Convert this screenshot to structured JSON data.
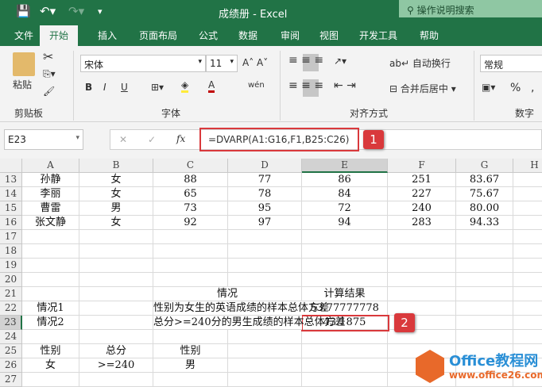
{
  "title_bar": {
    "title": "成绩册  -  Excel",
    "search": "操作说明搜索"
  },
  "tabs": [
    "文件",
    "开始",
    "插入",
    "页面布局",
    "公式",
    "数据",
    "审阅",
    "视图",
    "开发工具",
    "帮助"
  ],
  "ribbon": {
    "paste": "粘贴",
    "font_name": "宋体",
    "font_size": "11",
    "wrap": "自动换行",
    "merge": "合并后居中",
    "number_format": "常规",
    "groups": {
      "clipboard": "剪贴板",
      "font": "字体",
      "align": "对齐方式",
      "number": "数字"
    },
    "bold": "B",
    "italic": "I",
    "underline": "U",
    "percent": "%",
    "comma": ","
  },
  "formula_bar": {
    "name_box": "E23",
    "fx": "fx",
    "formula": "=DVARP(A1:G16,F1,B25:C26)"
  },
  "badges": [
    "1",
    "2"
  ],
  "columns": [
    "A",
    "B",
    "C",
    "D",
    "E",
    "F",
    "G",
    "H"
  ],
  "rows": [
    {
      "n": "13",
      "cells": {
        "A": "孙静",
        "B": "女",
        "C": "88",
        "D": "77",
        "E": "86",
        "F": "251",
        "G": "83.67"
      }
    },
    {
      "n": "14",
      "cells": {
        "A": "李丽",
        "B": "女",
        "C": "65",
        "D": "78",
        "E": "84",
        "F": "227",
        "G": "75.67"
      }
    },
    {
      "n": "15",
      "cells": {
        "A": "曹雷",
        "B": "男",
        "C": "73",
        "D": "95",
        "E": "72",
        "F": "240",
        "G": "80.00"
      }
    },
    {
      "n": "16",
      "cells": {
        "A": "张文静",
        "B": "女",
        "C": "92",
        "D": "97",
        "E": "94",
        "F": "283",
        "G": "94.33"
      }
    },
    {
      "n": "17",
      "cells": {}
    },
    {
      "n": "18",
      "cells": {}
    },
    {
      "n": "19",
      "cells": {}
    },
    {
      "n": "20",
      "cells": {}
    },
    {
      "n": "21",
      "cells": {
        "C": "情况",
        "E": "计算结果"
      }
    },
    {
      "n": "22",
      "cells": {
        "A": "情况1",
        "C": "性别为女生的英语成绩的样本总体方差",
        "E": "53.77777778"
      }
    },
    {
      "n": "23",
      "cells": {
        "A": "情况2",
        "C": "总分>=240分的男生成绩的样本总体方差",
        "E": "43.1875"
      }
    },
    {
      "n": "24",
      "cells": {}
    },
    {
      "n": "25",
      "cells": {
        "A": "性别",
        "B": "总分",
        "C": "性别"
      }
    },
    {
      "n": "26",
      "cells": {
        "A": "女",
        "B": ">=240",
        "C": "男"
      }
    },
    {
      "n": "27",
      "cells": {}
    }
  ],
  "watermark": {
    "name": "Office教程网",
    "url": "www.office26.com"
  },
  "colors": {
    "excel_green": "#217346",
    "annotation_red": "#d9393c"
  }
}
